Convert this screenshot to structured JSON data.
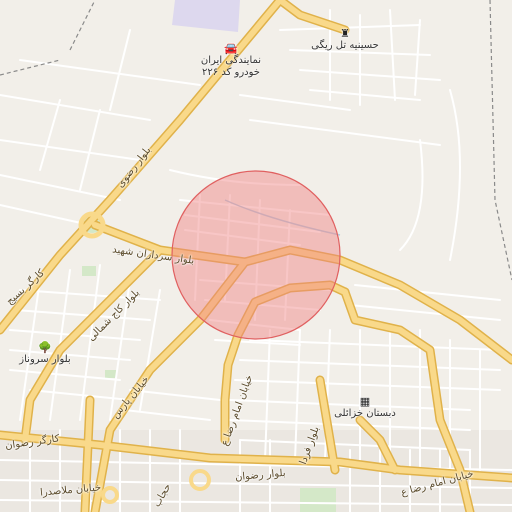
{
  "map": {
    "highlight_color": "#f28b8b",
    "major_road_color": "#f7d07a",
    "minor_road_color": "#ffffff",
    "land_color": "#f2efe9"
  },
  "pois": [
    {
      "name": "نمایندگی ایران خودرو کد ۲۲۶",
      "icon": "car-icon"
    },
    {
      "name": "حسینیه تل ریگی",
      "icon": "mosque-icon"
    },
    {
      "name": "بلوار سروناز",
      "icon": "tree-icon"
    },
    {
      "name": "دبستان خزائلی",
      "icon": "school-icon"
    }
  ],
  "roads": {
    "razavi": "بلوار رضوی",
    "sardaran": "بلوار سرداران شهید",
    "basij": "کارگر بسیج",
    "kaj": "بلوار کاج شمالی",
    "pars": "خیابان پارس",
    "reza": "خیابان امام رضا ع",
    "reza2": "خیابان امام رضا ع",
    "ferdowsi": "بلوار فردا",
    "rezvan": "بلوار رضوان",
    "kargar_rezvan": "کارگر رضوان",
    "molasadra": "خیابان ملاصدرا",
    "hejab": "حجاب"
  }
}
